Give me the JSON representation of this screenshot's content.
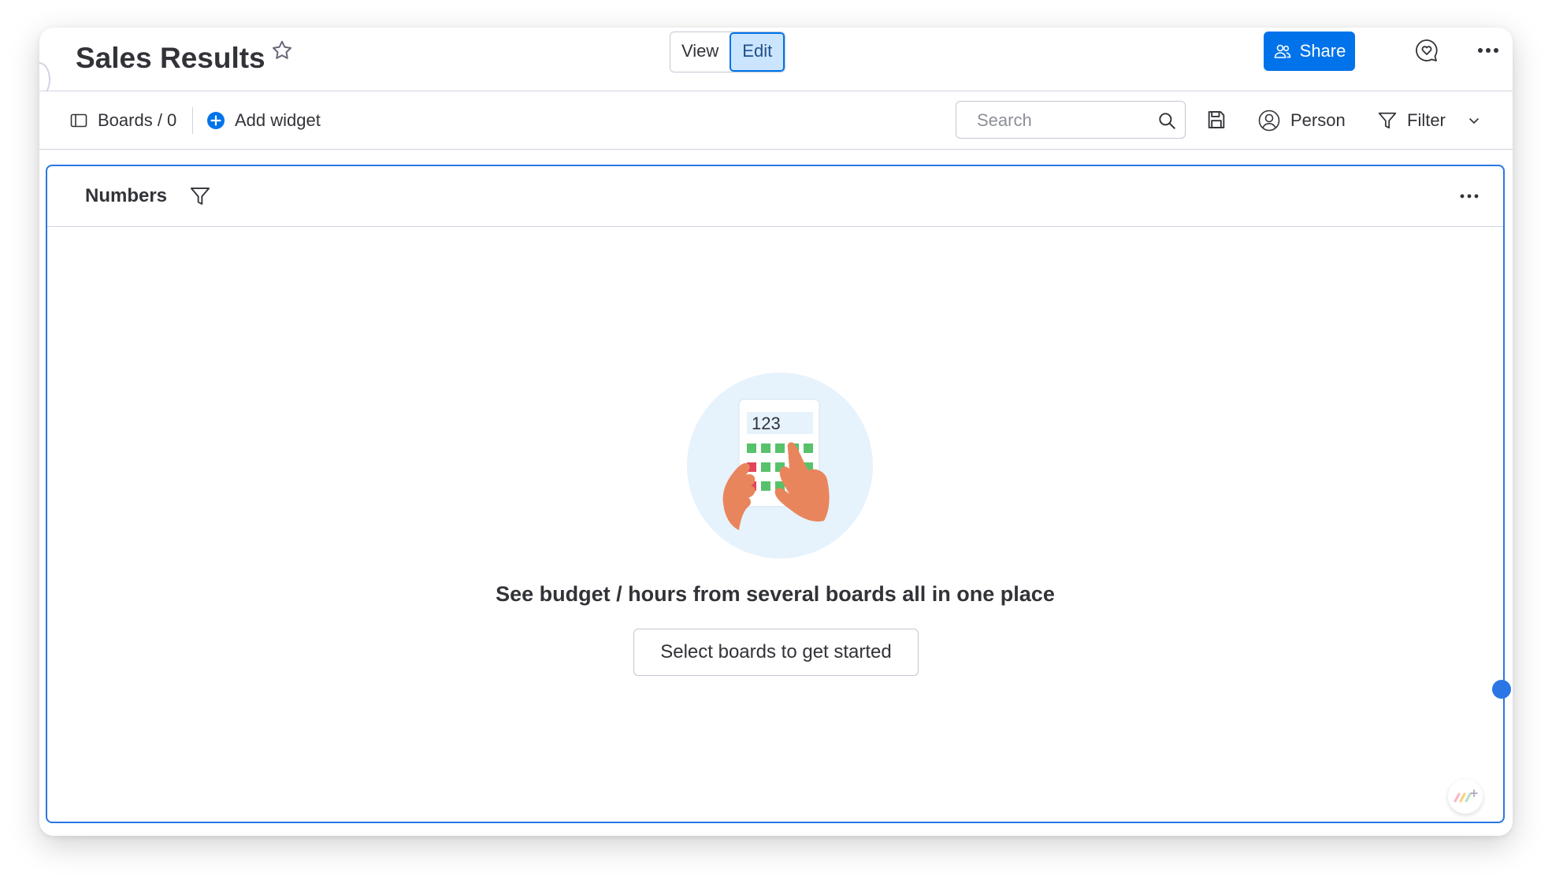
{
  "header": {
    "title": "Sales Results",
    "view_label": "View",
    "edit_label": "Edit",
    "share_label": "Share"
  },
  "toolbar": {
    "boards_label": "Boards / 0",
    "add_widget_label": "Add widget",
    "search_placeholder": "Search",
    "person_label": "Person",
    "filter_label": "Filter"
  },
  "widget": {
    "title": "Numbers",
    "illustration_number": "123",
    "empty_message": "See budget / hours from several boards all in one place",
    "cta_label": "Select boards to get started"
  },
  "colors": {
    "primary": "#0073ea",
    "widget_border": "#2b76e5",
    "text": "#323338",
    "key_green": "#57c26b",
    "key_red": "#e2445c",
    "hand": "#e9855c",
    "illus_bg": "#e6f2fc"
  },
  "icons": {
    "star": "star-icon",
    "share": "people-icon",
    "chat": "chat-heart-icon",
    "more": "more-horizontal-icon",
    "boards": "sidebar-panel-icon",
    "add": "plus-circle-icon",
    "search": "search-icon",
    "save": "save-icon",
    "person": "person-circle-icon",
    "filter": "filter-icon",
    "chevron": "chevron-down-icon"
  }
}
